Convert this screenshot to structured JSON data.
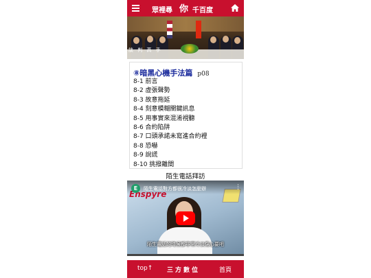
{
  "header": {
    "title_left": "眾裡尋",
    "title_center": "你",
    "title_right": "千百度",
    "icons": [
      "menu-icon",
      "home-icon"
    ]
  },
  "banner": {
    "caption": "談 判 高 手"
  },
  "chapter": {
    "heading": "⑧暗黑心機手法篇",
    "page": "p08",
    "items": [
      "8-1 前言",
      "8-2 虛張聲勢",
      "8-3 故意拖延",
      "8-4 刻意模糊關鍵訊息",
      "8-5 用事實來混淆視聽",
      "8-6 合約陷阱",
      "8-7 口頭承諾未寫進合約裡",
      "8-8 恐嚇",
      "8-9 說謊",
      "8-10 挑撥離間"
    ]
  },
  "video_section": {
    "title": "陌生電話拜訪",
    "channel_initial": "E",
    "video_title": "陌生電話對方都很冷淡怎麼辦",
    "brand": "Enspyre",
    "subtitle": "陌生電話的時候都非常冷淡傷心要吧"
  },
  "footer": {
    "top_label": "top↑",
    "middle_label": "三方數位",
    "home_label": "首頁"
  },
  "colors": {
    "brand_red": "#c8102e",
    "heading_blue": "#1a2a9c"
  }
}
